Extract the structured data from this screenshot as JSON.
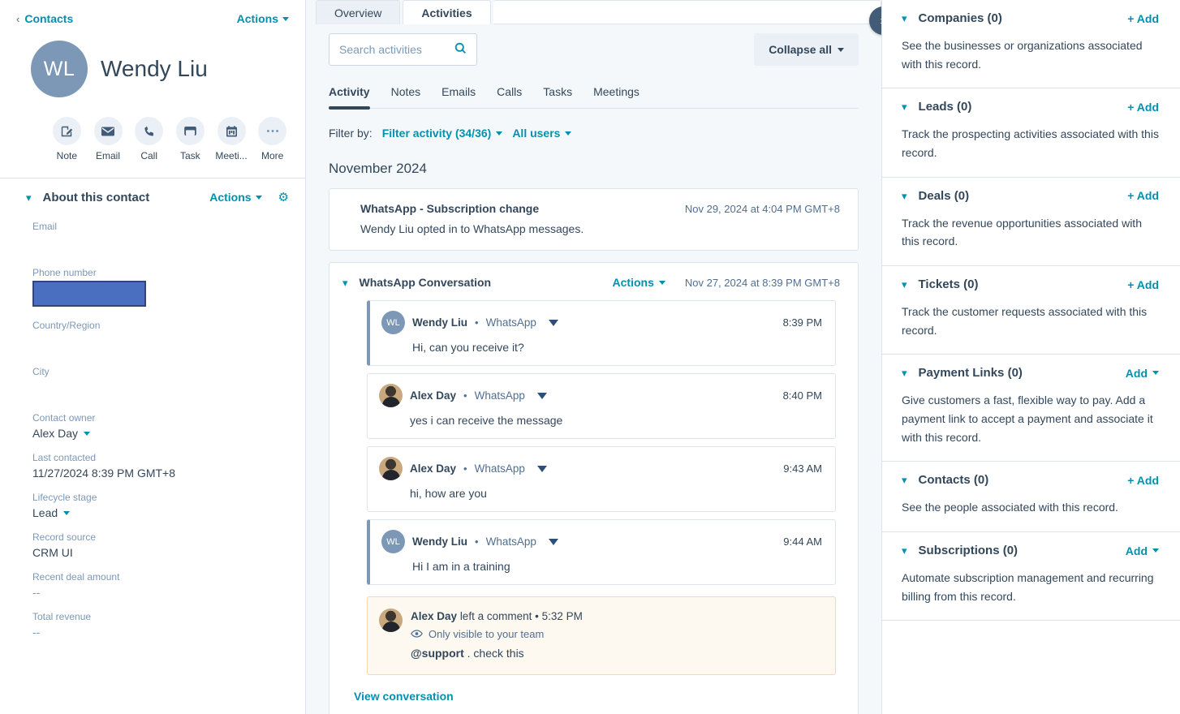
{
  "left": {
    "breadcrumb": "Contacts",
    "breadcrumb_back_icon": "chevron-left-icon",
    "actions_label": "Actions",
    "avatar_initials": "WL",
    "contact_name": "Wendy Liu",
    "quick_actions": [
      {
        "label": "Note",
        "icon": "note-icon"
      },
      {
        "label": "Email",
        "icon": "email-icon"
      },
      {
        "label": "Call",
        "icon": "phone-icon"
      },
      {
        "label": "Task",
        "icon": "task-icon"
      },
      {
        "label": "Meeti...",
        "icon": "calendar-icon"
      },
      {
        "label": "More",
        "icon": "ellipsis-icon"
      }
    ],
    "about": {
      "title": "About this contact",
      "actions_label": "Actions",
      "settings_icon": "gear-icon"
    },
    "properties": [
      {
        "label": "Email",
        "value": ""
      },
      {
        "label": "Phone number",
        "value": "",
        "redacted": true
      },
      {
        "label": "Country/Region",
        "value": ""
      },
      {
        "label": "City",
        "value": ""
      },
      {
        "label": "Contact owner",
        "value": "Alex Day",
        "dropdown": true
      },
      {
        "label": "Last contacted",
        "value": "11/27/2024 8:39 PM GMT+8"
      },
      {
        "label": "Lifecycle stage",
        "value": "Lead",
        "dropdown": true
      },
      {
        "label": "Record source",
        "value": "CRM UI"
      },
      {
        "label": "Recent deal amount",
        "value": "--",
        "muted": true
      },
      {
        "label": "Total revenue",
        "value": "--",
        "muted": true
      }
    ]
  },
  "center": {
    "record_tabs": [
      {
        "label": "Overview",
        "active": false
      },
      {
        "label": "Activities",
        "active": true
      }
    ],
    "collapse_toggle_icon": "double-chevron-right-icon",
    "search": {
      "placeholder": "Search activities",
      "value": "",
      "icon": "search-icon"
    },
    "collapse_all_label": "Collapse all",
    "sub_tabs": [
      {
        "label": "Activity",
        "active": true
      },
      {
        "label": "Notes",
        "active": false
      },
      {
        "label": "Emails",
        "active": false
      },
      {
        "label": "Calls",
        "active": false
      },
      {
        "label": "Tasks",
        "active": false
      },
      {
        "label": "Meetings",
        "active": false
      }
    ],
    "filter": {
      "label": "Filter by:",
      "activity_filter": "Filter activity (34/36)",
      "user_filter": "All users"
    },
    "month_heading": "November 2024",
    "subscription_card": {
      "title": "WhatsApp - Subscription change",
      "timestamp": "Nov 29, 2024 at 4:04 PM GMT+8",
      "description": "Wendy Liu opted in to WhatsApp messages."
    },
    "conversation": {
      "title": "WhatsApp Conversation",
      "actions_label": "Actions",
      "timestamp": "Nov 27, 2024 at 8:39 PM GMT+8",
      "messages": [
        {
          "author": "Wendy Liu",
          "channel": "WhatsApp",
          "time": "8:39 PM",
          "text": "Hi, can you receive it?",
          "avatar_type": "initials",
          "avatar_initials": "WL",
          "inbound": true
        },
        {
          "author": "Alex Day",
          "channel": "WhatsApp",
          "time": "8:40 PM",
          "text": "yes i can receive the message",
          "avatar_type": "photo",
          "avatar_initials": "",
          "inbound": false
        },
        {
          "author": "Alex Day",
          "channel": "WhatsApp",
          "time": "9:43 AM",
          "text": "hi, how are you",
          "avatar_type": "photo",
          "avatar_initials": "",
          "inbound": false
        },
        {
          "author": "Wendy Liu",
          "channel": "WhatsApp",
          "time": "9:44 AM",
          "text": "Hi I am in a training",
          "avatar_type": "initials",
          "avatar_initials": "WL",
          "inbound": true
        }
      ],
      "comment": {
        "author": "Alex Day",
        "action_text": "left a comment",
        "separator": "•",
        "time": "5:32 PM",
        "visibility": "Only visible to your team",
        "visibility_icon": "eye-icon",
        "mention": "@support",
        "body": ". check this"
      },
      "view_link": "View conversation"
    }
  },
  "right": {
    "panels": [
      {
        "title": "Companies (0)",
        "add_label": "+ Add",
        "add_dropdown": false,
        "description": "See the businesses or organizations associated with this record."
      },
      {
        "title": "Leads (0)",
        "add_label": "+ Add",
        "add_dropdown": false,
        "description": "Track the prospecting activities associated with this record."
      },
      {
        "title": "Deals (0)",
        "add_label": "+ Add",
        "add_dropdown": false,
        "description": "Track the revenue opportunities associated with this record."
      },
      {
        "title": "Tickets (0)",
        "add_label": "+ Add",
        "add_dropdown": false,
        "description": "Track the customer requests associated with this record."
      },
      {
        "title": "Payment Links (0)",
        "add_label": "Add",
        "add_dropdown": true,
        "description": "Give customers a fast, flexible way to pay. Add a payment link to accept a payment and associate it with this record."
      },
      {
        "title": "Contacts (0)",
        "add_label": "+ Add",
        "add_dropdown": false,
        "description": "See the people associated with this record."
      },
      {
        "title": "Subscriptions (0)",
        "add_label": "Add",
        "add_dropdown": true,
        "description": "Automate subscription management and recurring billing from this record."
      }
    ]
  },
  "colors": {
    "link": "#0091ae",
    "text": "#33475b",
    "muted": "#7c98b6",
    "page_bg": "#f5f8fa",
    "border": "#dfe3eb",
    "avatar": "#7c98b6",
    "comment_bg": "#fdf8f0",
    "comment_border": "#f5d9a8",
    "redaction": "#4a6fc0"
  }
}
